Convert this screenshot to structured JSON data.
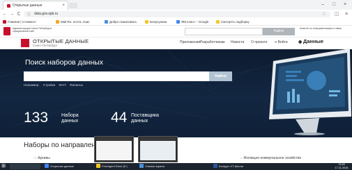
{
  "browser": {
    "tab_title": "Открытые данные",
    "tab_close": "×",
    "window_buttons": {
      "minimize": "–",
      "maximize": "□",
      "close": "×"
    },
    "nav": {
      "back": "←",
      "forward": "→",
      "reload": "C"
    },
    "url": "data.gov.spb.ru",
    "bookmarks": [
      {
        "label": "Главная | Стоимост",
        "color": "#c8102e"
      },
      {
        "label": "Mail.Ru: почта, поис",
        "color": "#f5a623"
      },
      {
        "label": "Добро пожаловать",
        "color": "#4a90d9"
      },
      {
        "label": "Бонусуника",
        "color": "#f3c624"
      },
      {
        "label": "ЯМ класс – Google",
        "color": "#4285f4"
      },
      {
        "label": "Смотреть подборку",
        "color": "#f3c624"
      }
    ]
  },
  "gov_banner": {
    "left_text": "Администрация Санкт-Петербурга официальный сайт",
    "search_button": "Найти",
    "right_text": "Комитет по информатизации и связи"
  },
  "site": {
    "title": "ОТКРЫТЫЕ ДАННЫЕ",
    "subtitle": "Санкт-Петербург",
    "nav": [
      "Приложения",
      "Разработчикам",
      "Новости",
      "О проекте",
      "Войти"
    ],
    "data_label": "Данные"
  },
  "hero": {
    "title": "Поиск наборов данных",
    "search_placeholder": "",
    "search_button": "Найти",
    "examples": [
      "Например:",
      "Стройки",
      "Wi-Fi",
      "Финансы"
    ],
    "stats": [
      {
        "number": "133",
        "label": "Набора данных"
      },
      {
        "number": "44",
        "label": "Поставщика данных"
      }
    ]
  },
  "directions": {
    "title": "Наборы по направлениям",
    "items": [
      "Архивы",
      "Жилищно-коммунальное хозяйство"
    ]
  },
  "taskbar": {
    "items": [
      {
        "label": "Открытые данные",
        "color": "#4285f4"
      },
      {
        "label": "FreeAgent Drive (E:)",
        "color": "#f3c624"
      },
      {
        "label": "Снимок экрана",
        "color": "#4a90d9"
      },
      {
        "label": "Конкурс «IT-Школа",
        "color": "#2b5797"
      }
    ],
    "time": "13:49",
    "date": "17.11.2016"
  },
  "colors": {
    "accent_red": "#c8102e",
    "hero_bg": "#0f1f37",
    "search_btn": "#b1c3d3"
  }
}
